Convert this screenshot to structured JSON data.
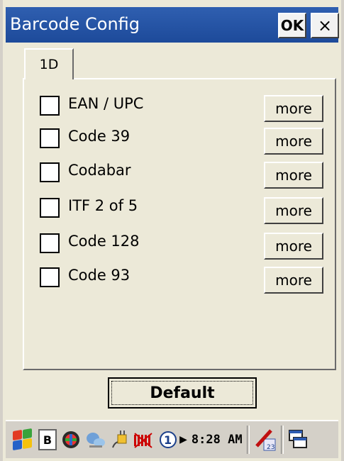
{
  "window": {
    "title": "Barcode Config",
    "ok_label": "OK",
    "close_label": "×"
  },
  "tabs": [
    {
      "label": "1D",
      "selected": true
    }
  ],
  "options": [
    {
      "label": "EAN / UPC",
      "checked": false,
      "more_label": "more"
    },
    {
      "label": "Code 39",
      "checked": false,
      "more_label": "more"
    },
    {
      "label": "Codabar",
      "checked": false,
      "more_label": "more"
    },
    {
      "label": "ITF 2 of 5",
      "checked": false,
      "more_label": "more"
    },
    {
      "label": "Code 128",
      "checked": false,
      "more_label": "more"
    },
    {
      "label": "Code 93",
      "checked": false,
      "more_label": "more"
    }
  ],
  "default_button": {
    "label": "Default"
  },
  "taskbar": {
    "input_indicator": "B",
    "page_indicator": "1",
    "clock": "8:28 AM",
    "icons": [
      "windows-start-icon",
      "input-mode-icon",
      "network-icon",
      "connection-icon",
      "power-plug-icon",
      "signal-icon",
      "page-indicator-icon",
      "clock",
      "input-panel-icon",
      "switch-window-icon"
    ]
  },
  "colors": {
    "titlebar": "#1d4a9a",
    "background": "#ece9d8",
    "taskbar": "#d4d0c8"
  }
}
